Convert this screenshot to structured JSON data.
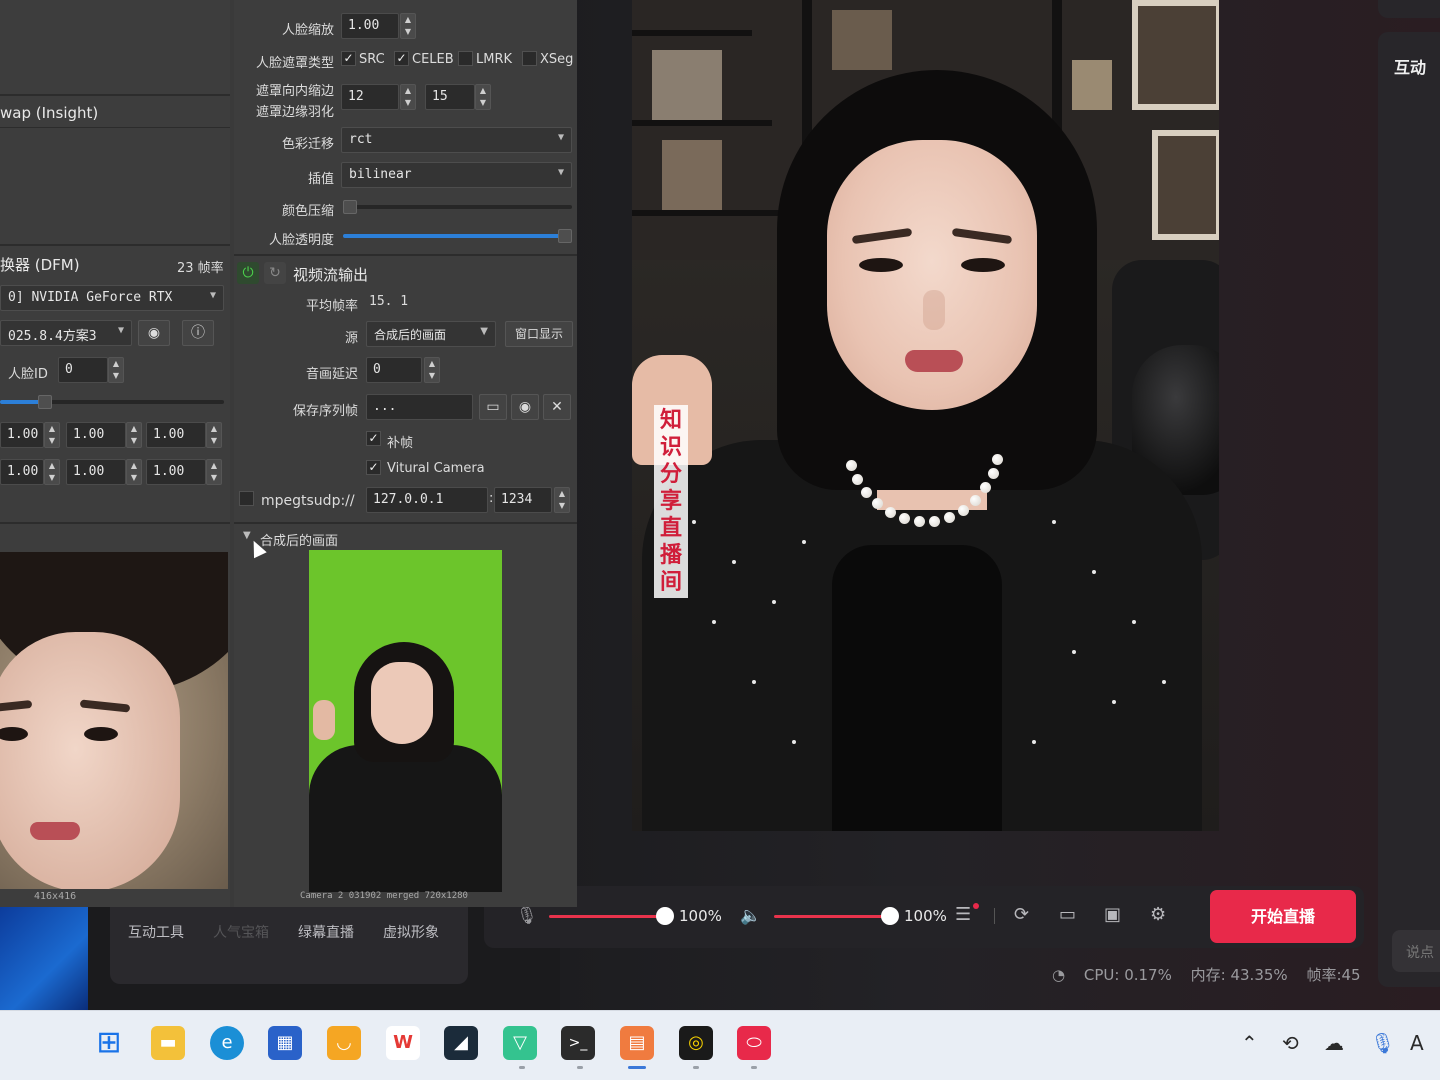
{
  "dfl": {
    "left": {
      "swap_header": "wap (Insight)",
      "dfm_header": "换器 (DFM)",
      "fps": "23 帧率",
      "device": "0] NVIDIA GeForce RTX",
      "model": "025.8.4方案3",
      "face_id_label": "人脸ID",
      "face_id_value": "0",
      "row1": [
        "1.00",
        "1.00",
        "1.00"
      ],
      "row2": [
        "1.00",
        "1.00",
        "1.00"
      ],
      "face_caption": "416x416"
    },
    "mid": {
      "face_scale_label": "人脸缩放",
      "face_scale_value": "1.00",
      "mask_type_label": "人脸遮罩类型",
      "mask_src": "SRC",
      "mask_celeb": "CELEB",
      "mask_lmrk": "LMRK",
      "mask_xseg": "XSeg",
      "erode_label": "遮罩向内缩边",
      "blur_label": "遮罩边缘羽化",
      "erode_value": "12",
      "blur_value": "15",
      "color_transfer_label": "色彩迁移",
      "color_transfer_value": "rct",
      "interp_label": "插值",
      "interp_value": "bilinear",
      "color_compress_label": "颜色压缩",
      "face_opacity_label": "人脸透明度",
      "face_opacity_level": 0.98,
      "stream_header": "视频流输出",
      "avg_fps_label": "平均帧率",
      "avg_fps_value": "15. 1",
      "source_label": "源",
      "source_value": "合成后的画面",
      "window_btn": "窗口显示",
      "av_delay_label": "音画延迟",
      "av_delay_value": "0",
      "save_seq_label": "保存序列帧",
      "save_seq_value": "...",
      "fill_frames": "补帧",
      "virtual_camera": "Vitural Camera",
      "mpegts_label": "mpegtsudp://",
      "mpegts_host": "127.0.0.1",
      "mpegts_port": "1234",
      "merged_header": "合成后的画面",
      "merged_caption": "Camera 2 031902 merged 720x1280"
    }
  },
  "preview": {
    "banner_text": "知识分享直播间"
  },
  "right_panel": {
    "title": "互动",
    "input_placeholder": "说点"
  },
  "controls": {
    "mic_volume": "100%",
    "mic_level": 1.0,
    "speaker_volume": "100%",
    "speaker_level": 1.0,
    "start_label": "开始直播"
  },
  "status": {
    "cpu": "CPU: 0.17%",
    "mem": "内存: 43.35%",
    "fps": "帧率:45"
  },
  "tools": {
    "items": [
      "互动工具",
      "人气宝箱",
      "绿幕直播",
      "虚拟形象"
    ]
  },
  "taskbar": {
    "apps": [
      "start",
      "file-explorer",
      "edge",
      "store",
      "ime",
      "wps",
      "terminal-app",
      "green-app",
      "cmd",
      "orange-app",
      "camera-app",
      "red-app"
    ]
  },
  "colors": {
    "accent": "#e8294a",
    "slider": "#2c7fd8",
    "greenscreen": "#6cc52b"
  }
}
